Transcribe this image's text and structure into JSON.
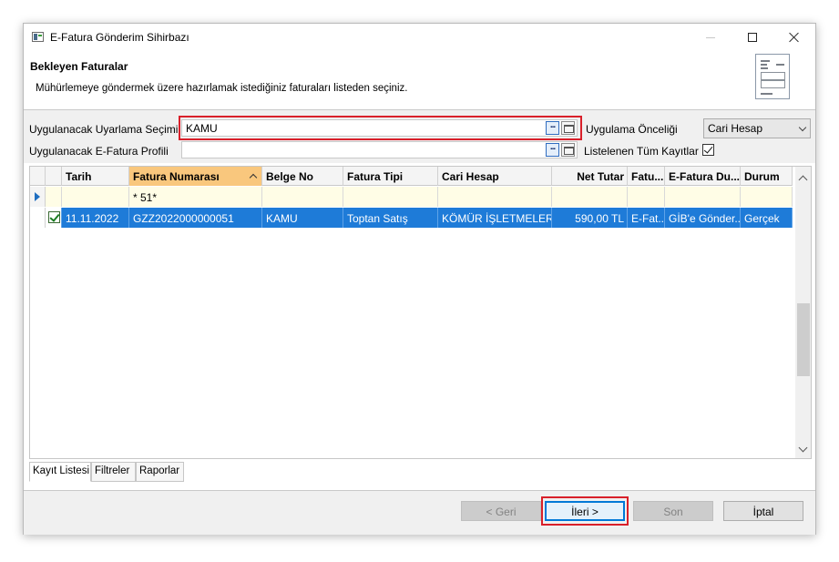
{
  "window": {
    "title": "E-Fatura Gönderim Sihirbazı"
  },
  "header": {
    "title": "Bekleyen Faturalar",
    "description": "Mühürlemeye göndermek üzere hazırlamak istediğiniz faturaları listeden seçiniz."
  },
  "form": {
    "warning_label": "Uygulanacak Uyarlama Seçimi",
    "warning_value": "KAMU",
    "profile_label": "Uygulanacak E-Fatura Profili",
    "profile_value": "",
    "priority_label": "Uygulama Önceliği",
    "priority_value": "Cari Hesap",
    "list_all_label": "Listelenen Tüm Kayıtlar",
    "list_all_checked": true,
    "ellipsis_glyph": "..."
  },
  "grid": {
    "columns": [
      "Tarih",
      "Fatura Numarası",
      "Belge No",
      "Fatura Tipi",
      "Cari Hesap",
      "Net Tutar",
      "Fatu...",
      "E-Fatura Du...",
      "Durum"
    ],
    "sorted_column": "Fatura Numarası",
    "filter_row": [
      "",
      "* 51*",
      "",
      "",
      "",
      "",
      "",
      "",
      ""
    ],
    "rows": [
      {
        "selected": true,
        "checked": true,
        "cells": [
          "11.11.2022",
          "GZZ2022000000051",
          "KAMU",
          "Toptan Satış",
          "KÖMÜR İŞLETMELER ...",
          "590,00 TL",
          "E-Fat...",
          "GİB'e Gönder...",
          "Gerçek"
        ]
      }
    ]
  },
  "tabs": [
    "Kayıt Listesi",
    "Filtreler",
    "Raporlar"
  ],
  "buttons": {
    "back": "< Geri",
    "next": "İleri >",
    "finish": "Son",
    "cancel": "İptal"
  },
  "colors": {
    "selection": "#1e7bd8",
    "sorted_header": "#f9c77d",
    "highlight": "#d9202a",
    "filter_row": "#fffde6"
  }
}
